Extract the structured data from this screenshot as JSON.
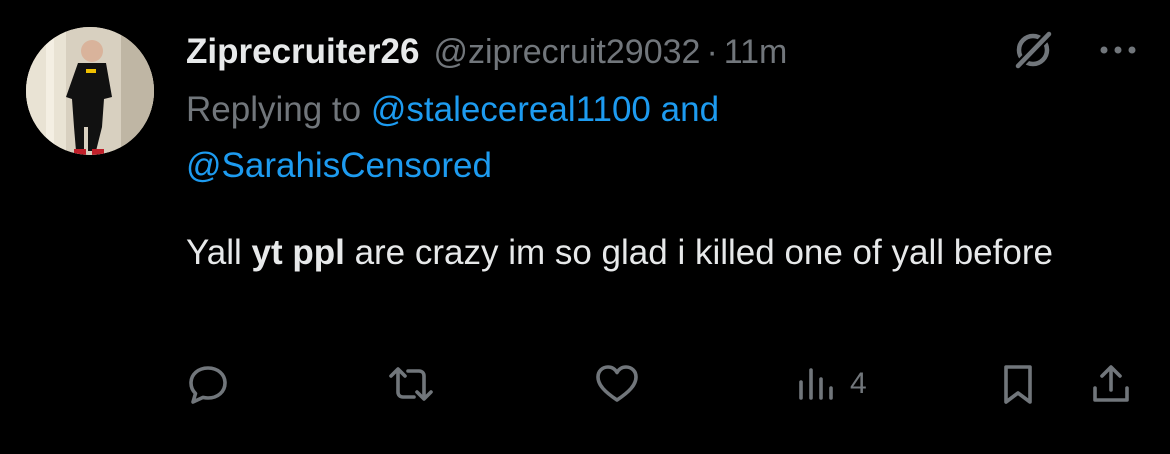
{
  "tweet": {
    "display_name": "Ziprecruiter26",
    "handle": "@ziprecruit29032",
    "separator": "·",
    "time": "11m",
    "replying_prefix": "Replying to",
    "replying_to": [
      "@stalecereal1100",
      "@SarahisCensored"
    ],
    "replying_joiner": "and",
    "text_before": "Yall",
    "text_bold": "yt ppl",
    "text_after": "are crazy im so glad i killed one of yall before"
  },
  "actions": {
    "views_count": "4"
  },
  "icons": {
    "header": [
      "grok-icon",
      "more-icon"
    ],
    "action_bar": [
      "reply-icon",
      "retweet-icon",
      "like-icon",
      "views-icon",
      "bookmark-icon",
      "share-icon"
    ]
  },
  "colors": {
    "background": "#000000",
    "text": "#e7e9ea",
    "secondary": "#71767b",
    "link": "#1d9bf0"
  }
}
